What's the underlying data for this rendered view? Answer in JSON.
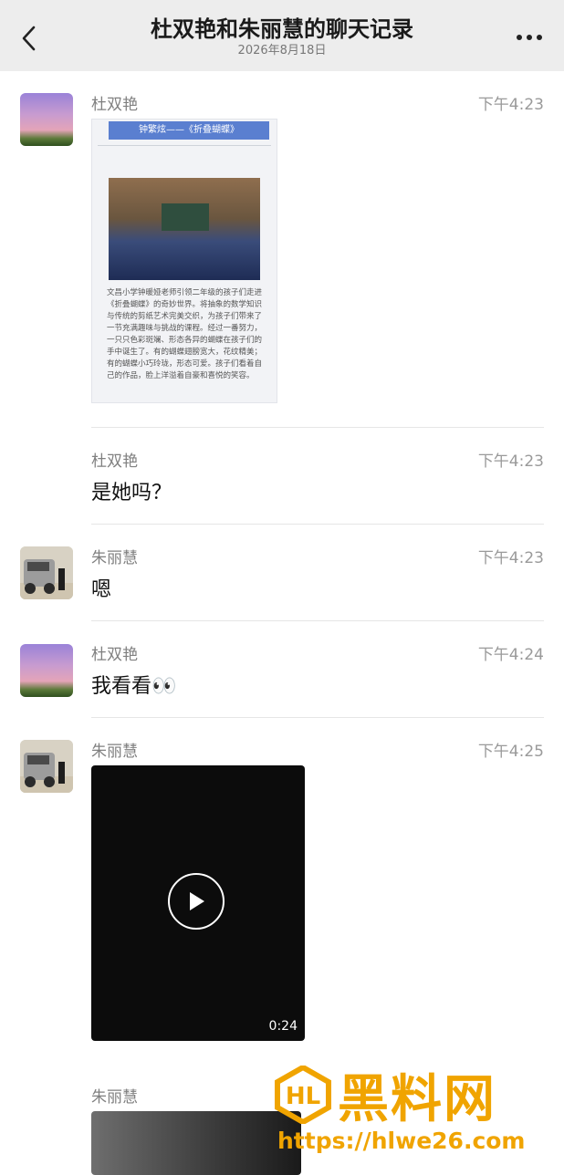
{
  "header": {
    "title": "杜双艳和朱丽慧的聊天记录",
    "date": "2026年8月18日"
  },
  "doc_image": {
    "banner": "钟繁炫——《折叠蝴蝶》",
    "caption": "文昌小学钟暖娅老师引领二年级的孩子们走进《折叠蝴蝶》的奇妙世界。将抽象的数学知识与传统的剪纸艺术完美交织，为孩子们带来了一节充满趣味与挑战的课程。经过一番努力，一只只色彩斑斓、形态各异的蝴蝶在孩子们的手中诞生了。有的蝴蝶翅膀宽大，花纹精美；有的蝴蝶小巧玲珑，形态可爱。孩子们看着自己的作品，脸上洋溢着自豪和喜悦的笑容。"
  },
  "messages": [
    {
      "sender": "杜双艳",
      "time": "下午4:23",
      "type": "image"
    },
    {
      "sender": "杜双艳",
      "time": "下午4:23",
      "text": "是她吗？"
    },
    {
      "sender": "朱丽慧",
      "time": "下午4:23",
      "text": "嗯"
    },
    {
      "sender": "杜双艳",
      "time": "下午4:24",
      "text": "我看看👀"
    },
    {
      "sender": "朱丽慧",
      "time": "下午4:25",
      "type": "video",
      "duration": "0:24"
    },
    {
      "sender": "朱丽慧",
      "type": "video"
    }
  ],
  "watermark": {
    "text": "黑料网",
    "url": "https://hlwe26.com"
  },
  "icons": {
    "back": "chevron-left-icon",
    "more": "more-dots-icon",
    "play": "play-icon"
  }
}
